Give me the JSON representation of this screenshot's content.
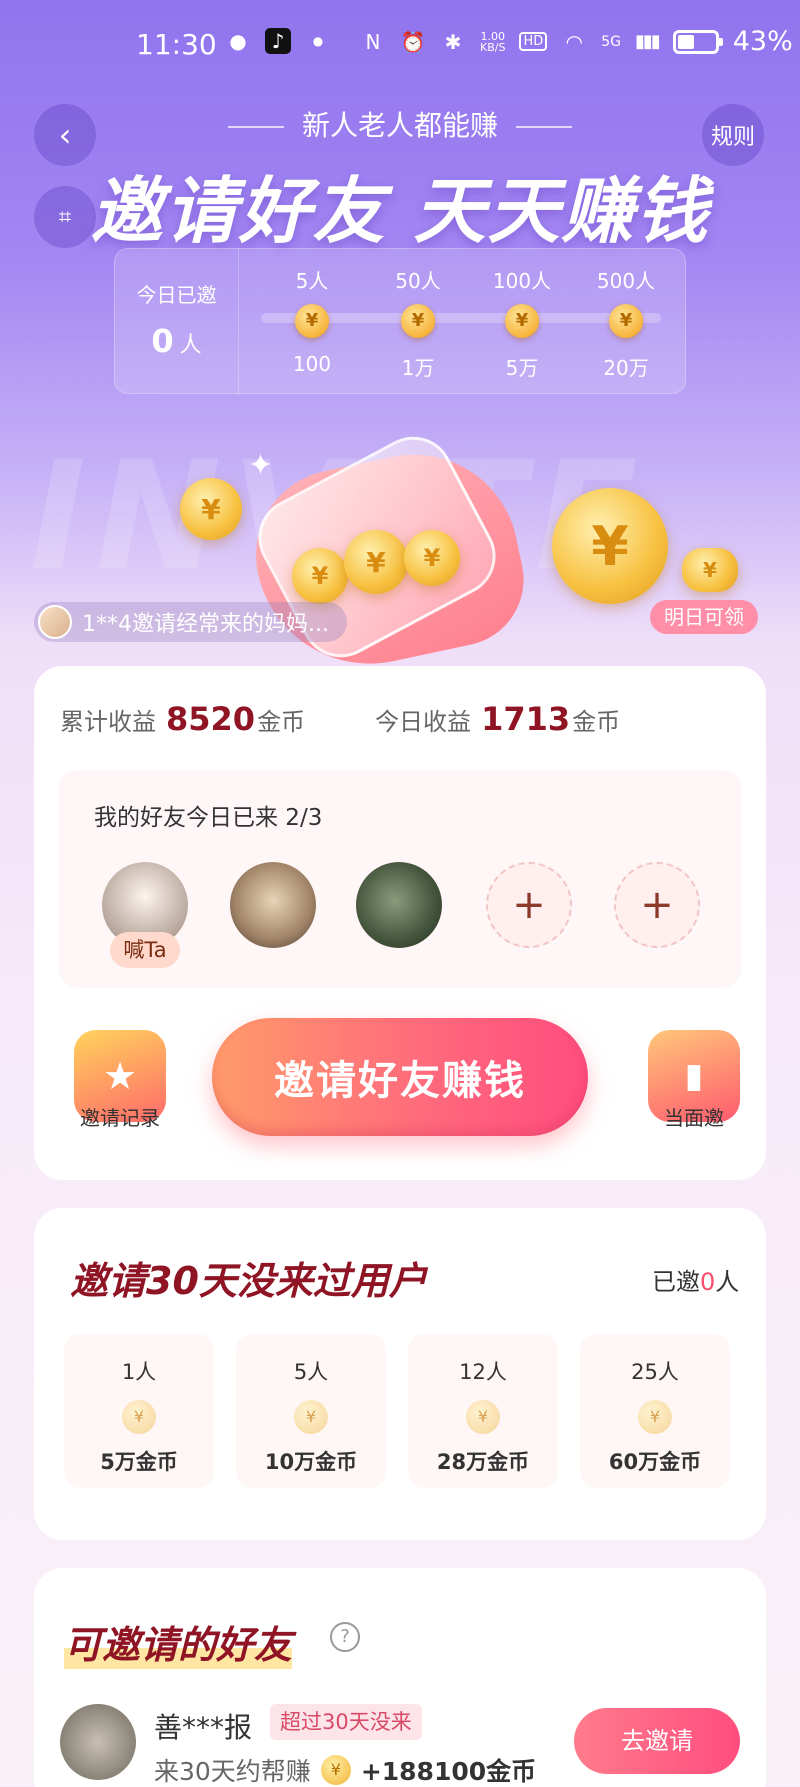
{
  "status_bar": {
    "time": "11:30",
    "net_speed": "1.00\nKB/S",
    "hd": "HD",
    "signal": "5G",
    "battery": "43%"
  },
  "header": {
    "back_icon": "chevron-left-icon",
    "scan_icon": "scan-icon",
    "rules_label": "规则",
    "subtitle": "新人老人都能赚",
    "headline": "邀请好友 天天赚钱"
  },
  "progress": {
    "today_label": "今日已邀",
    "today_value": "0",
    "today_unit": "人",
    "milestones": [
      {
        "people": "5人",
        "reward": "100"
      },
      {
        "people": "50人",
        "reward": "1万"
      },
      {
        "people": "100人",
        "reward": "5万"
      },
      {
        "people": "500人",
        "reward": "20万"
      }
    ]
  },
  "hero": {
    "bg_letters": "INVITE",
    "ticker": "1**4邀请经常来的妈妈...",
    "tomorrow_badge": "明日可领"
  },
  "earnings": {
    "total_label": "累计收益",
    "total_value": "8520",
    "total_unit": "金币",
    "today_label": "今日收益",
    "today_value": "1713",
    "today_unit": "金币"
  },
  "friends": {
    "title": "我的好友今日已来 2/3",
    "shout_label": "喊Ta"
  },
  "actions": {
    "record_label": "邀请记录",
    "cta_label": "邀请好友赚钱",
    "face_label": "当面邀"
  },
  "inactive": {
    "title": "邀请30天没来过用户",
    "invited_prefix": "已邀",
    "invited_value": "0",
    "invited_suffix": "人",
    "tiers": [
      {
        "people": "1人",
        "reward": "5万金币"
      },
      {
        "people": "5人",
        "reward": "10万金币"
      },
      {
        "people": "12人",
        "reward": "28万金币"
      },
      {
        "people": "25人",
        "reward": "60万金币"
      }
    ]
  },
  "invitable": {
    "title": "可邀请的好友",
    "help_icon": "question-icon",
    "user": {
      "name": "善***报",
      "tag": "超过30天没来",
      "sub": "来30天约帮赚",
      "reward": "+188100金币",
      "button": "去邀请"
    }
  },
  "colors": {
    "accent": "#8f1424",
    "cta": "#ff4d7e",
    "bg_top": "#8f74ee"
  }
}
